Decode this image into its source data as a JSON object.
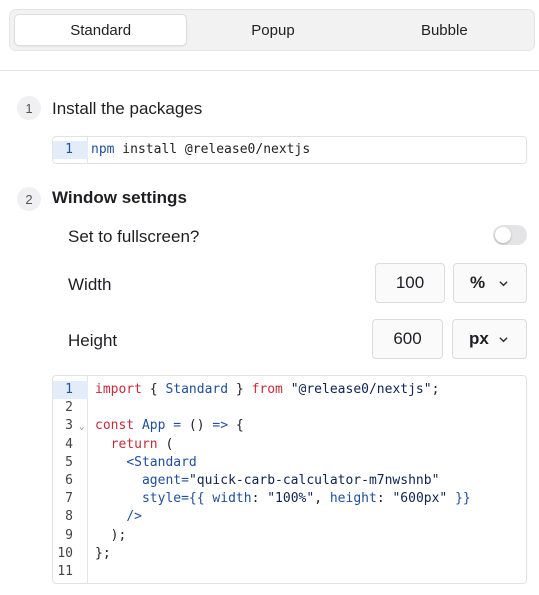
{
  "tabs": [
    {
      "label": "Standard",
      "active": true
    },
    {
      "label": "Popup",
      "active": false
    },
    {
      "label": "Bubble",
      "active": false
    }
  ],
  "step1": {
    "number": "1",
    "title": "Install the packages",
    "code_line_number": "1",
    "code": {
      "cmd": "npm",
      "rest": " install @release0/nextjs"
    }
  },
  "step2": {
    "number": "2",
    "title": "Window settings"
  },
  "settings": {
    "fullscreen_label": "Set to fullscreen?",
    "fullscreen_on": false,
    "width_label": "Width",
    "width_value": "100",
    "width_unit": "%",
    "height_label": "Height",
    "height_value": "600",
    "height_unit": "px"
  },
  "snippet": {
    "line_numbers": [
      "1",
      "2",
      "3",
      "4",
      "5",
      "6",
      "7",
      "8",
      "9",
      "10",
      "11"
    ],
    "lines": [
      [
        {
          "t": "import",
          "c": "kw"
        },
        {
          "t": " { ",
          "c": "pl"
        },
        {
          "t": "Standard",
          "c": "var"
        },
        {
          "t": " } ",
          "c": "pl"
        },
        {
          "t": "from",
          "c": "kw"
        },
        {
          "t": " ",
          "c": "pl"
        },
        {
          "t": "\"@release0/nextjs\"",
          "c": "str"
        },
        {
          "t": ";",
          "c": "pl"
        }
      ],
      [],
      [
        {
          "t": "const",
          "c": "kw"
        },
        {
          "t": " ",
          "c": "pl"
        },
        {
          "t": "App",
          "c": "var"
        },
        {
          "t": " ",
          "c": "pl"
        },
        {
          "t": "=",
          "c": "var"
        },
        {
          "t": " () ",
          "c": "pl"
        },
        {
          "t": "=>",
          "c": "var"
        },
        {
          "t": " {",
          "c": "pl"
        }
      ],
      [
        {
          "t": "  ",
          "c": "pl"
        },
        {
          "t": "return",
          "c": "kw"
        },
        {
          "t": " (",
          "c": "pl"
        }
      ],
      [
        {
          "t": "    ",
          "c": "pl"
        },
        {
          "t": "<Standard",
          "c": "var"
        }
      ],
      [
        {
          "t": "      ",
          "c": "pl"
        },
        {
          "t": "agent",
          "c": "var"
        },
        {
          "t": "=",
          "c": "var"
        },
        {
          "t": "\"quick-carb-calculator-m7nwshnb\"",
          "c": "str"
        }
      ],
      [
        {
          "t": "      ",
          "c": "pl"
        },
        {
          "t": "style",
          "c": "var"
        },
        {
          "t": "={{ ",
          "c": "var"
        },
        {
          "t": "width",
          "c": "var"
        },
        {
          "t": ": ",
          "c": "pl"
        },
        {
          "t": "\"100%\"",
          "c": "str"
        },
        {
          "t": ", ",
          "c": "pl"
        },
        {
          "t": "height",
          "c": "var"
        },
        {
          "t": ": ",
          "c": "pl"
        },
        {
          "t": "\"600px\"",
          "c": "str"
        },
        {
          "t": " }}",
          "c": "var"
        }
      ],
      [
        {
          "t": "    ",
          "c": "pl"
        },
        {
          "t": "/>",
          "c": "var"
        }
      ],
      [
        {
          "t": "  );",
          "c": "pl"
        }
      ],
      [
        {
          "t": "};",
          "c": "pl"
        }
      ],
      []
    ]
  }
}
